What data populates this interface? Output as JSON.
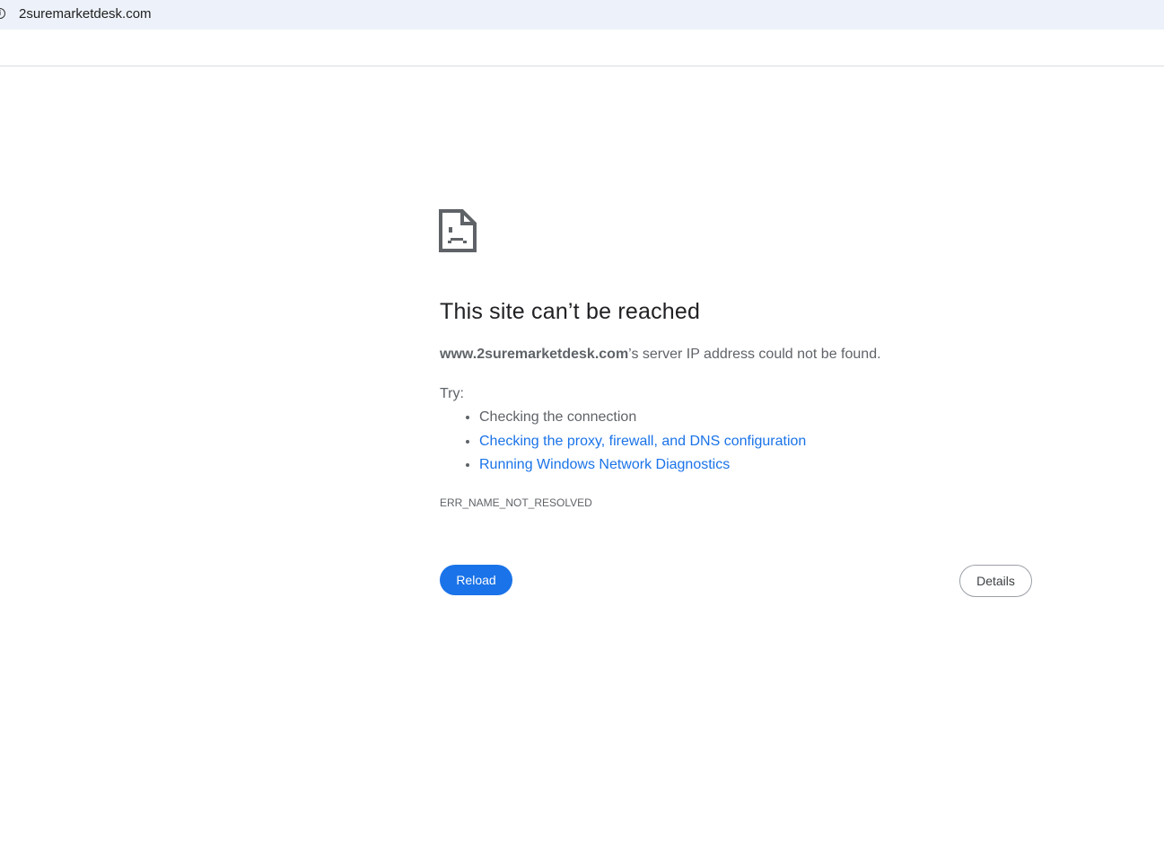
{
  "browser": {
    "url": "2suremarketdesk.com"
  },
  "error": {
    "title": "This site can’t be reached",
    "host": "www.2suremarketdesk.com",
    "message": "’s server IP address could not be found.",
    "try_label": "Try:",
    "suggestions": [
      {
        "text": "Checking the connection",
        "link": false
      },
      {
        "text": "Checking the proxy, firewall, and DNS configuration",
        "link": true
      },
      {
        "text": "Running Windows Network Diagnostics",
        "link": true
      }
    ],
    "code": "ERR_NAME_NOT_RESOLVED",
    "reload_label": "Reload",
    "details_label": "Details"
  }
}
